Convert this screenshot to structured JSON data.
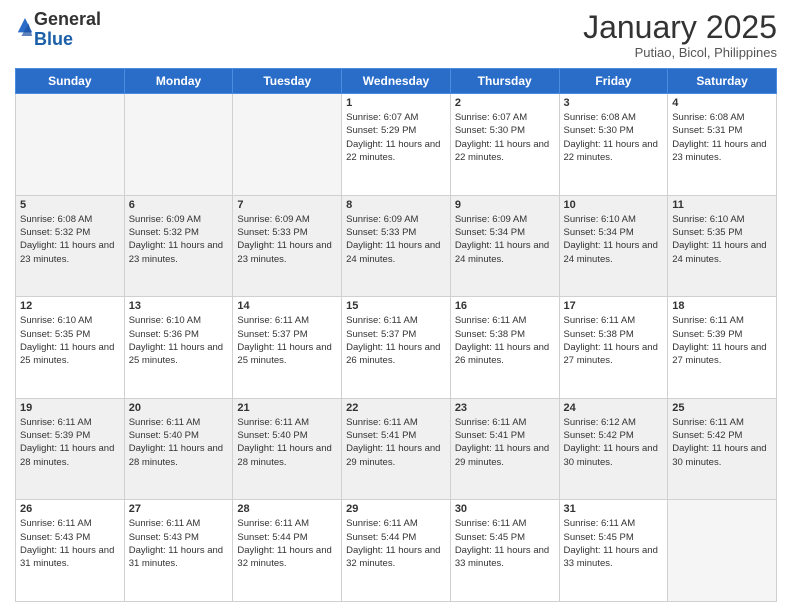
{
  "logo": {
    "general": "General",
    "blue": "Blue"
  },
  "title": "January 2025",
  "subtitle": "Putiao, Bicol, Philippines",
  "days_header": [
    "Sunday",
    "Monday",
    "Tuesday",
    "Wednesday",
    "Thursday",
    "Friday",
    "Saturday"
  ],
  "weeks": [
    [
      {
        "day": "",
        "sunrise": "",
        "sunset": "",
        "daylight": ""
      },
      {
        "day": "",
        "sunrise": "",
        "sunset": "",
        "daylight": ""
      },
      {
        "day": "",
        "sunrise": "",
        "sunset": "",
        "daylight": ""
      },
      {
        "day": "1",
        "sunrise": "Sunrise: 6:07 AM",
        "sunset": "Sunset: 5:29 PM",
        "daylight": "Daylight: 11 hours and 22 minutes."
      },
      {
        "day": "2",
        "sunrise": "Sunrise: 6:07 AM",
        "sunset": "Sunset: 5:30 PM",
        "daylight": "Daylight: 11 hours and 22 minutes."
      },
      {
        "day": "3",
        "sunrise": "Sunrise: 6:08 AM",
        "sunset": "Sunset: 5:30 PM",
        "daylight": "Daylight: 11 hours and 22 minutes."
      },
      {
        "day": "4",
        "sunrise": "Sunrise: 6:08 AM",
        "sunset": "Sunset: 5:31 PM",
        "daylight": "Daylight: 11 hours and 23 minutes."
      }
    ],
    [
      {
        "day": "5",
        "sunrise": "Sunrise: 6:08 AM",
        "sunset": "Sunset: 5:32 PM",
        "daylight": "Daylight: 11 hours and 23 minutes."
      },
      {
        "day": "6",
        "sunrise": "Sunrise: 6:09 AM",
        "sunset": "Sunset: 5:32 PM",
        "daylight": "Daylight: 11 hours and 23 minutes."
      },
      {
        "day": "7",
        "sunrise": "Sunrise: 6:09 AM",
        "sunset": "Sunset: 5:33 PM",
        "daylight": "Daylight: 11 hours and 23 minutes."
      },
      {
        "day": "8",
        "sunrise": "Sunrise: 6:09 AM",
        "sunset": "Sunset: 5:33 PM",
        "daylight": "Daylight: 11 hours and 24 minutes."
      },
      {
        "day": "9",
        "sunrise": "Sunrise: 6:09 AM",
        "sunset": "Sunset: 5:34 PM",
        "daylight": "Daylight: 11 hours and 24 minutes."
      },
      {
        "day": "10",
        "sunrise": "Sunrise: 6:10 AM",
        "sunset": "Sunset: 5:34 PM",
        "daylight": "Daylight: 11 hours and 24 minutes."
      },
      {
        "day": "11",
        "sunrise": "Sunrise: 6:10 AM",
        "sunset": "Sunset: 5:35 PM",
        "daylight": "Daylight: 11 hours and 24 minutes."
      }
    ],
    [
      {
        "day": "12",
        "sunrise": "Sunrise: 6:10 AM",
        "sunset": "Sunset: 5:35 PM",
        "daylight": "Daylight: 11 hours and 25 minutes."
      },
      {
        "day": "13",
        "sunrise": "Sunrise: 6:10 AM",
        "sunset": "Sunset: 5:36 PM",
        "daylight": "Daylight: 11 hours and 25 minutes."
      },
      {
        "day": "14",
        "sunrise": "Sunrise: 6:11 AM",
        "sunset": "Sunset: 5:37 PM",
        "daylight": "Daylight: 11 hours and 25 minutes."
      },
      {
        "day": "15",
        "sunrise": "Sunrise: 6:11 AM",
        "sunset": "Sunset: 5:37 PM",
        "daylight": "Daylight: 11 hours and 26 minutes."
      },
      {
        "day": "16",
        "sunrise": "Sunrise: 6:11 AM",
        "sunset": "Sunset: 5:38 PM",
        "daylight": "Daylight: 11 hours and 26 minutes."
      },
      {
        "day": "17",
        "sunrise": "Sunrise: 6:11 AM",
        "sunset": "Sunset: 5:38 PM",
        "daylight": "Daylight: 11 hours and 27 minutes."
      },
      {
        "day": "18",
        "sunrise": "Sunrise: 6:11 AM",
        "sunset": "Sunset: 5:39 PM",
        "daylight": "Daylight: 11 hours and 27 minutes."
      }
    ],
    [
      {
        "day": "19",
        "sunrise": "Sunrise: 6:11 AM",
        "sunset": "Sunset: 5:39 PM",
        "daylight": "Daylight: 11 hours and 28 minutes."
      },
      {
        "day": "20",
        "sunrise": "Sunrise: 6:11 AM",
        "sunset": "Sunset: 5:40 PM",
        "daylight": "Daylight: 11 hours and 28 minutes."
      },
      {
        "day": "21",
        "sunrise": "Sunrise: 6:11 AM",
        "sunset": "Sunset: 5:40 PM",
        "daylight": "Daylight: 11 hours and 28 minutes."
      },
      {
        "day": "22",
        "sunrise": "Sunrise: 6:11 AM",
        "sunset": "Sunset: 5:41 PM",
        "daylight": "Daylight: 11 hours and 29 minutes."
      },
      {
        "day": "23",
        "sunrise": "Sunrise: 6:11 AM",
        "sunset": "Sunset: 5:41 PM",
        "daylight": "Daylight: 11 hours and 29 minutes."
      },
      {
        "day": "24",
        "sunrise": "Sunrise: 6:12 AM",
        "sunset": "Sunset: 5:42 PM",
        "daylight": "Daylight: 11 hours and 30 minutes."
      },
      {
        "day": "25",
        "sunrise": "Sunrise: 6:11 AM",
        "sunset": "Sunset: 5:42 PM",
        "daylight": "Daylight: 11 hours and 30 minutes."
      }
    ],
    [
      {
        "day": "26",
        "sunrise": "Sunrise: 6:11 AM",
        "sunset": "Sunset: 5:43 PM",
        "daylight": "Daylight: 11 hours and 31 minutes."
      },
      {
        "day": "27",
        "sunrise": "Sunrise: 6:11 AM",
        "sunset": "Sunset: 5:43 PM",
        "daylight": "Daylight: 11 hours and 31 minutes."
      },
      {
        "day": "28",
        "sunrise": "Sunrise: 6:11 AM",
        "sunset": "Sunset: 5:44 PM",
        "daylight": "Daylight: 11 hours and 32 minutes."
      },
      {
        "day": "29",
        "sunrise": "Sunrise: 6:11 AM",
        "sunset": "Sunset: 5:44 PM",
        "daylight": "Daylight: 11 hours and 32 minutes."
      },
      {
        "day": "30",
        "sunrise": "Sunrise: 6:11 AM",
        "sunset": "Sunset: 5:45 PM",
        "daylight": "Daylight: 11 hours and 33 minutes."
      },
      {
        "day": "31",
        "sunrise": "Sunrise: 6:11 AM",
        "sunset": "Sunset: 5:45 PM",
        "daylight": "Daylight: 11 hours and 33 minutes."
      },
      {
        "day": "",
        "sunrise": "",
        "sunset": "",
        "daylight": ""
      }
    ]
  ]
}
